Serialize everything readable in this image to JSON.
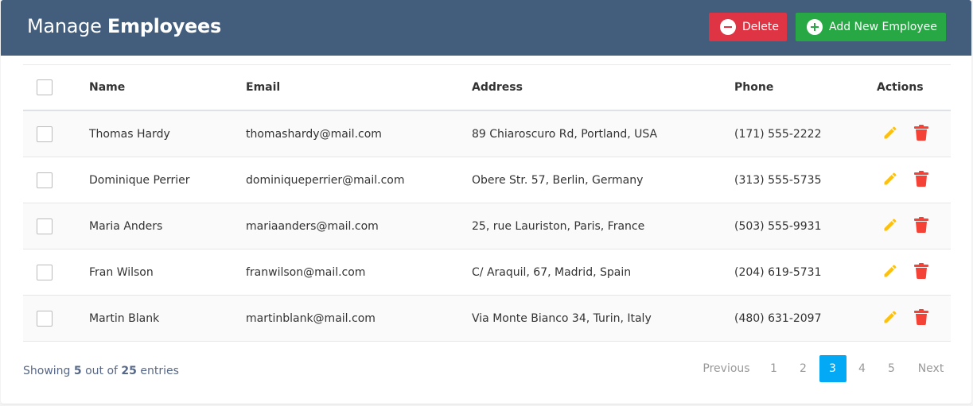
{
  "header": {
    "title_prefix": "Manage",
    "title_bold": "Employees",
    "delete_label": "Delete",
    "add_label": "Add New Employee"
  },
  "colors": {
    "header_bg": "#435d7d",
    "delete": "#df3444",
    "add": "#28a745",
    "edit_icon": "#ffc107",
    "delete_icon": "#f44336",
    "active_page": "#03a9f4"
  },
  "table": {
    "columns": [
      "Name",
      "Email",
      "Address",
      "Phone",
      "Actions"
    ],
    "rows": [
      {
        "name": "Thomas Hardy",
        "email": "thomashardy@mail.com",
        "address": "89 Chiaroscuro Rd, Portland, USA",
        "phone": "(171) 555-2222"
      },
      {
        "name": "Dominique Perrier",
        "email": "dominiqueperrier@mail.com",
        "address": "Obere Str. 57, Berlin, Germany",
        "phone": "(313) 555-5735"
      },
      {
        "name": "Maria Anders",
        "email": "mariaanders@mail.com",
        "address": "25, rue Lauriston, Paris, France",
        "phone": "(503) 555-9931"
      },
      {
        "name": "Fran Wilson",
        "email": "franwilson@mail.com",
        "address": "C/ Araquil, 67, Madrid, Spain",
        "phone": "(204) 619-5731"
      },
      {
        "name": "Martin Blank",
        "email": "martinblank@mail.com",
        "address": "Via Monte Bianco 34, Turin, Italy",
        "phone": "(480) 631-2097"
      }
    ]
  },
  "footer": {
    "showing": "Showing",
    "shown_count": "5",
    "out_of": "out of",
    "total": "25",
    "entries": "entries"
  },
  "pagination": {
    "previous": "Previous",
    "pages": [
      "1",
      "2",
      "3",
      "4",
      "5"
    ],
    "active_page": "3",
    "next": "Next"
  }
}
